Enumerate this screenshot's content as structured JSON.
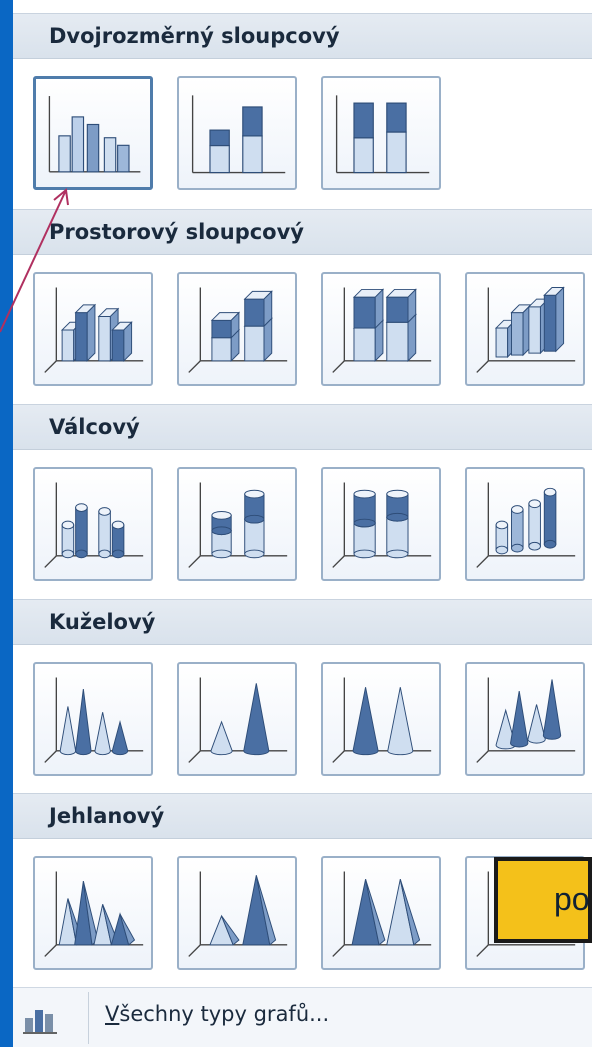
{
  "sections": [
    {
      "title": "Dvojrozměrný sloupcový",
      "kind": "col2d",
      "tiles": [
        "clustered",
        "stacked",
        "stacked100"
      ],
      "selected": 0
    },
    {
      "title": "Prostorový sloupcový",
      "kind": "col3d",
      "tiles": [
        "clustered",
        "stacked",
        "stacked100",
        "threeD"
      ]
    },
    {
      "title": "Válcový",
      "kind": "cylinder",
      "tiles": [
        "clustered",
        "stacked",
        "stacked100",
        "threeD"
      ]
    },
    {
      "title": "Kuželový",
      "kind": "cone",
      "tiles": [
        "clustered",
        "stacked",
        "stacked100",
        "threeD"
      ]
    },
    {
      "title": "Jehlanový",
      "kind": "pyramid",
      "tiles": [
        "clustered",
        "stacked",
        "stacked100",
        "threeD"
      ]
    }
  ],
  "footer": {
    "accel": "V",
    "rest": "šechny typy grafů...",
    "icon": "chart-icon"
  },
  "tooltip": {
    "text": "po"
  },
  "colors": {
    "background": "#0a67c4",
    "tile_border": "#9ab0c8",
    "dark_bar": "#4a6fa3",
    "light_bar": "#cfdef0",
    "tooltip": "#f4c11a"
  }
}
